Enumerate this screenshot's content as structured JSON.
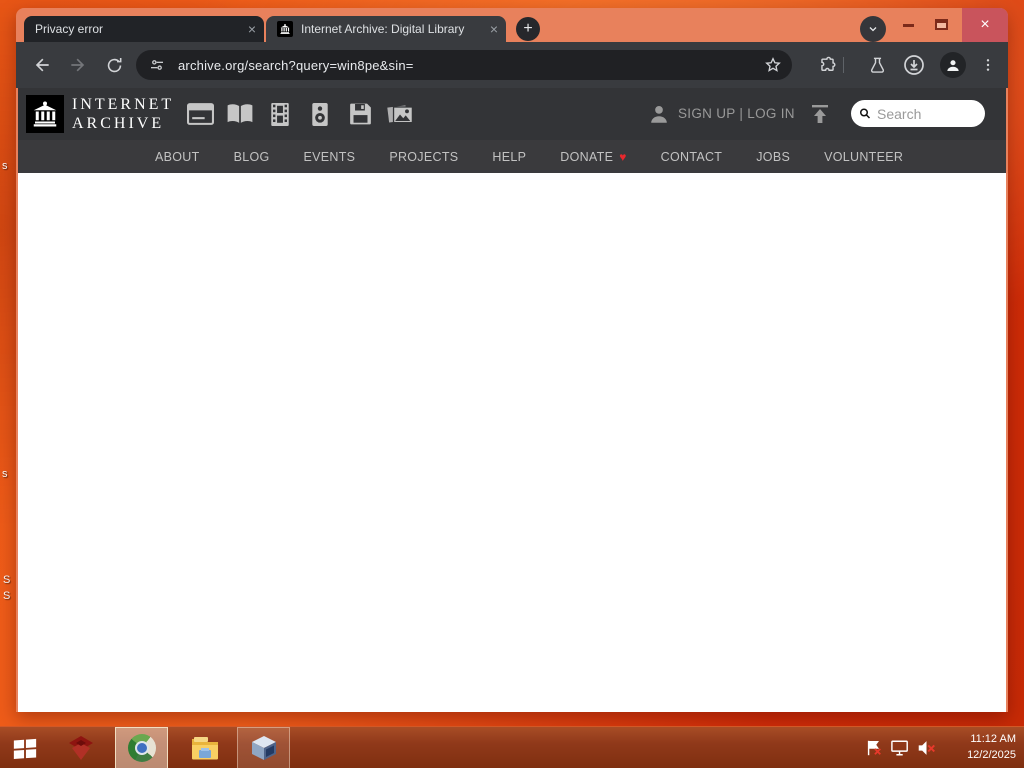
{
  "colors": {
    "desktop-orange": "#ee5a17",
    "desktop-red": "#d02c08",
    "frame-salmon": "#e8815c",
    "chrome-dark": "#393b3f",
    "omnibox-dark": "#202124",
    "close-red": "#c9545c",
    "ia-header-dark": "#333437",
    "ia-nav-dark": "#3a3a3d",
    "donate-heart-red": "#e8282d",
    "taskbar-brown": "#8c3414"
  },
  "browser": {
    "tabs": [
      {
        "title": "Privacy error"
      },
      {
        "title": "Internet Archive: Digital Library"
      }
    ],
    "new_tab_label": "+",
    "url": "archive.org/search?query=win8pe&sin="
  },
  "archive": {
    "logo": {
      "line1": "INTERNET",
      "line2": "ARCHIVE"
    },
    "media_icons": [
      "web-icon",
      "texts-icon",
      "video-icon",
      "audio-icon",
      "software-icon",
      "images-icon"
    ],
    "auth_text": "SIGN UP | LOG IN",
    "search_placeholder": "Search",
    "nav_items": [
      "ABOUT",
      "BLOG",
      "EVENTS",
      "PROJECTS",
      "HELP",
      "DONATE",
      "CONTACT",
      "JOBS",
      "VOLUNTEER"
    ]
  },
  "taskbar": {
    "time": "11:12 AM",
    "date": "12/2/2025",
    "app_icons": [
      "start-icon",
      "red-box-app-icon",
      "chrome-icon",
      "file-explorer-icon",
      "virtualbox-icon"
    ],
    "tray_icons": [
      "flag-alert-icon",
      "display-icon",
      "muted-speaker-icon"
    ]
  },
  "desktop": {
    "icon_label_fragments": [
      "s",
      "s",
      "S",
      "S"
    ]
  }
}
